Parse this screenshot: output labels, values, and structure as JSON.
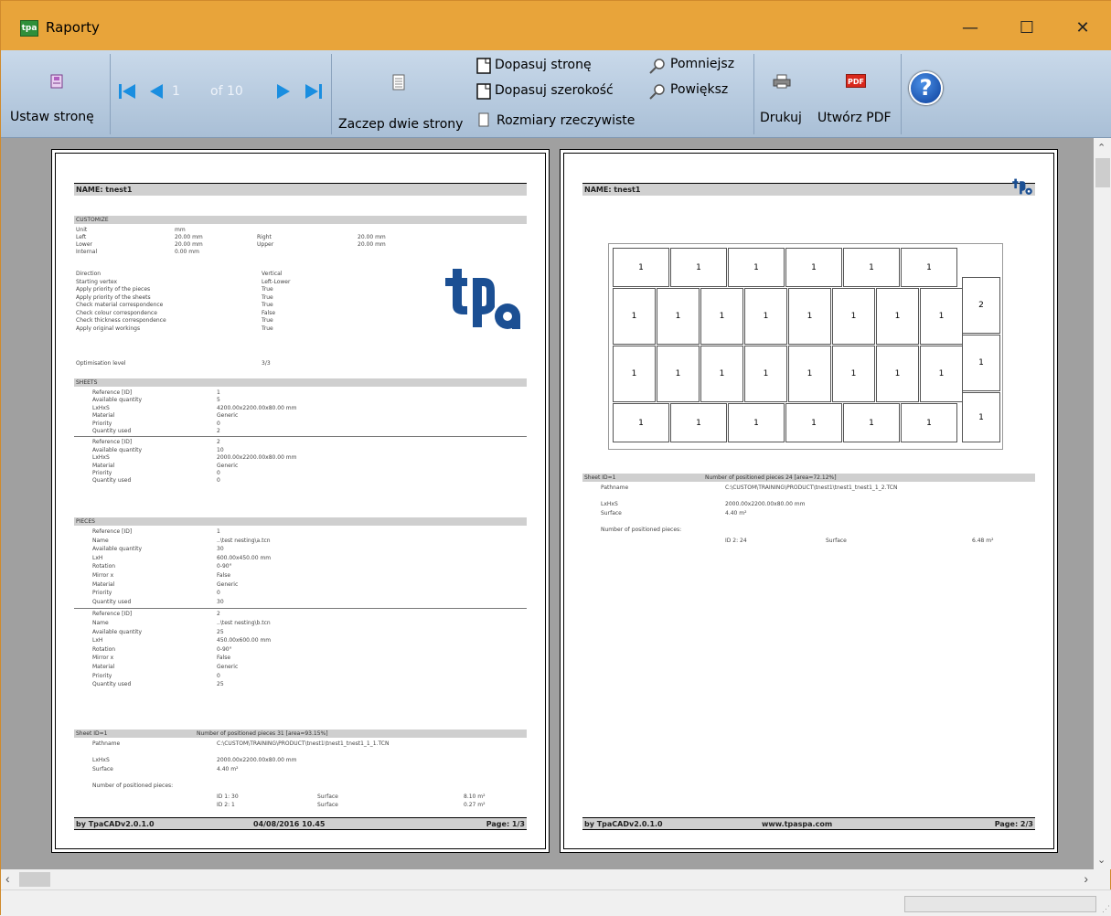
{
  "window": {
    "title": "Raporty",
    "app_icon": "tpa-report-icon",
    "minimize": "—",
    "maximize": "☐",
    "close": "✕"
  },
  "toolbar": {
    "page_setup": "Ustaw stronę",
    "page_current": "1",
    "page_of": "of 10",
    "two_pages": "Zaczep dwie strony",
    "fit_page": "Dopasuj stronę",
    "fit_width": "Dopasuj szerokość",
    "actual_size": "Rozmiary rzeczywiste",
    "zoom_out": "Pomniejsz",
    "zoom_in": "Powiększ",
    "print": "Drukuj",
    "create_pdf": "Utwórz PDF",
    "help": "?",
    "pdf_badge": "PDF"
  },
  "page1": {
    "name": "NAME: tnest1",
    "logo": "tpa",
    "customize_title": "CUSTOMIZE",
    "customize": [
      [
        "Unit",
        "mm",
        "",
        ""
      ],
      [
        "Left",
        "20.00 mm",
        "Right",
        "20.00 mm"
      ],
      [
        "Lower",
        "20.00 mm",
        "Upper",
        "20.00 mm"
      ],
      [
        "Internal",
        "0.00 mm",
        "",
        ""
      ]
    ],
    "options": [
      [
        "Direction",
        "Vertical"
      ],
      [
        "Starting vertex",
        "Left-Lower"
      ],
      [
        "Apply priority of the pieces",
        "True"
      ],
      [
        "Apply priority of the sheets",
        "True"
      ],
      [
        "Check material correspondence",
        "True"
      ],
      [
        "Check colour correspondence",
        "False"
      ],
      [
        "Check thickness correspondence",
        "True"
      ],
      [
        "Apply original workings",
        "True"
      ]
    ],
    "optimisation": [
      "Optimisation level",
      "3/3"
    ],
    "sheets_title": "SHEETS",
    "sheets": [
      [
        [
          "Reference [ID]",
          "1"
        ],
        [
          "Available quantity",
          "5"
        ],
        [
          "LxHxS",
          "4200.00x2200.00x80.00 mm"
        ],
        [
          "Material",
          "Generic"
        ],
        [
          "Priority",
          "0"
        ],
        [
          "Quantity used",
          "2"
        ]
      ],
      [
        [
          "Reference [ID]",
          "2"
        ],
        [
          "Available quantity",
          "10"
        ],
        [
          "LxHxS",
          "2000.00x2200.00x80.00 mm"
        ],
        [
          "Material",
          "Generic"
        ],
        [
          "Priority",
          "0"
        ],
        [
          "Quantity used",
          "0"
        ]
      ]
    ],
    "pieces_title": "PIECES",
    "pieces": [
      [
        [
          "Reference [ID]",
          "1"
        ],
        [
          "Name",
          "..\\test nesting\\a.tcn"
        ],
        [
          "Available quantity",
          "30"
        ],
        [
          "LxH",
          "600.00x450.00 mm"
        ],
        [
          "Rotation",
          "0-90°"
        ],
        [
          "Mirror x",
          "False"
        ],
        [
          "Material",
          "Generic"
        ],
        [
          "Priority",
          "0"
        ],
        [
          "Quantity used",
          "30"
        ]
      ],
      [
        [
          "Reference [ID]",
          "2"
        ],
        [
          "Name",
          "..\\test nesting\\b.tcn"
        ],
        [
          "Available quantity",
          "25"
        ],
        [
          "LxH",
          "450.00x600.00 mm"
        ],
        [
          "Rotation",
          "0-90°"
        ],
        [
          "Mirror x",
          "False"
        ],
        [
          "Material",
          "Generic"
        ],
        [
          "Priority",
          "0"
        ],
        [
          "Quantity used",
          "25"
        ]
      ]
    ],
    "sheet_header": [
      "Sheet  ID=1",
      "Number of positioned pieces  31  [area=93.15%]"
    ],
    "pathname": [
      "Pathname",
      "C:\\CUSTOM\\TRAINING\\PRODUCT\\tnest1\\tnest1_tnest1_1_1.TCN"
    ],
    "lxhxs": [
      "LxHxS",
      "2000.00x2200.00x80.00 mm"
    ],
    "surface": [
      "Surface",
      "4.40  m²"
    ],
    "npp": "Number of positioned pieces:",
    "id_rows": [
      [
        "ID 1: 30",
        "Surface",
        "8.10  m²"
      ],
      [
        "ID 2: 1",
        "Surface",
        "0.27  m²"
      ]
    ],
    "footer": {
      "left": "by TpaCADv2.0.1.0",
      "center": "04/08/2016 10.45",
      "right": "Page: 1/3"
    }
  },
  "page2": {
    "name": "NAME: tnest1",
    "logo": "tpa",
    "piece_label": "1",
    "piece2_label": "2",
    "sheet_header": [
      "Sheet  ID=1",
      "Number of positioned pieces  24  [area=72.12%]"
    ],
    "pathname": [
      "Pathname",
      "C:\\CUSTOM\\TRAINING\\PRODUCT\\tnest1\\tnest1_tnest1_1_2.TCN"
    ],
    "lxhxs": [
      "LxHxS",
      "2000.00x2200.00x80.00 mm"
    ],
    "surface": [
      "Surface",
      "4.40  m²"
    ],
    "npp": "Number of positioned pieces:",
    "id_rows": [
      [
        "ID 2: 24",
        "Surface",
        "6.48  m²"
      ]
    ],
    "footer": {
      "left": "by TpaCADv2.0.1.0",
      "center": "www.tpaspa.com",
      "right": "Page: 2/3"
    }
  }
}
